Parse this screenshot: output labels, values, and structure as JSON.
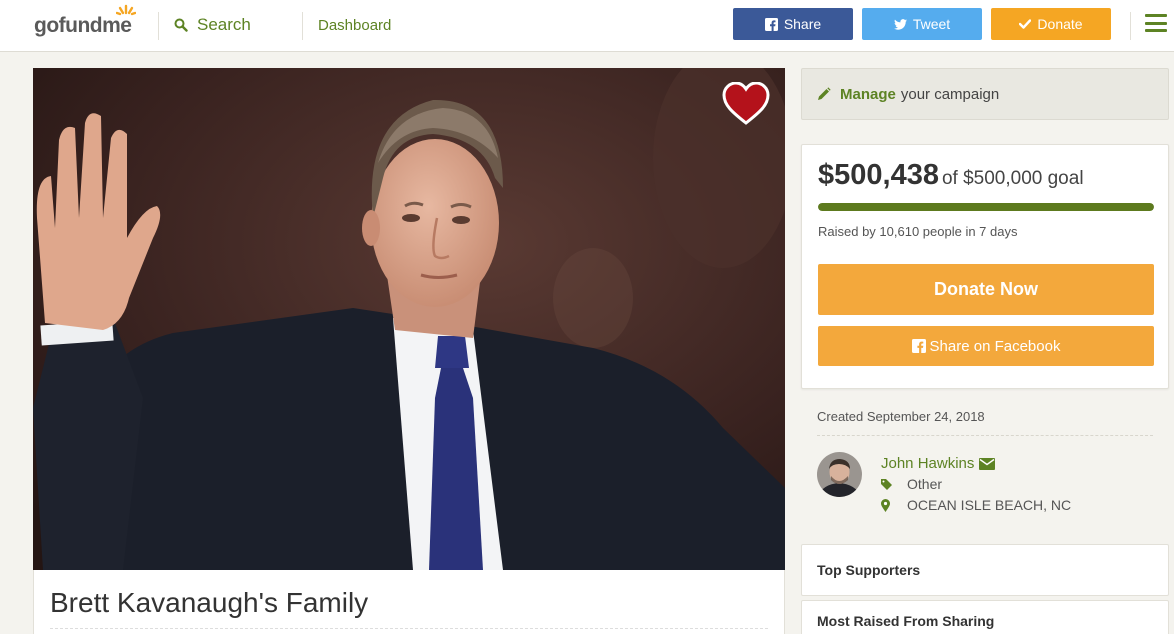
{
  "header": {
    "logo_text": "gofundme",
    "search_label": "Search",
    "dashboard_label": "Dashboard",
    "share_label": "Share",
    "tweet_label": "Tweet",
    "donate_label": "Donate",
    "icons": [
      "search-icon",
      "facebook-icon",
      "twitter-icon",
      "check-icon",
      "hamburger-menu-icon"
    ]
  },
  "campaign": {
    "title": "Brett Kavanaugh's Family",
    "hero_icons": [
      "heart-icon"
    ]
  },
  "sidebar": {
    "manage_bold": "Manage",
    "manage_rest": "your campaign",
    "amount_raised": "$500,438",
    "goal_text": "of $500,000 goal",
    "progress_fraction": 1.0,
    "raised_by": "Raised by 10,610 people in 7 days",
    "donate_now_label": "Donate Now",
    "share_facebook_label": "Share on Facebook",
    "created": "Created September 24, 2018",
    "organizer": {
      "name": "John Hawkins",
      "category": "Other",
      "location": "OCEAN ISLE BEACH, NC"
    },
    "top_supporters_label": "Top Supporters",
    "most_raised_label": "Most Raised From Sharing"
  },
  "colors": {
    "brand_green": "#5d8324",
    "donate_orange": "#f3a83c",
    "facebook_blue": "#3b5998",
    "twitter_blue": "#55acee",
    "progress_green": "#5d7a1e"
  }
}
